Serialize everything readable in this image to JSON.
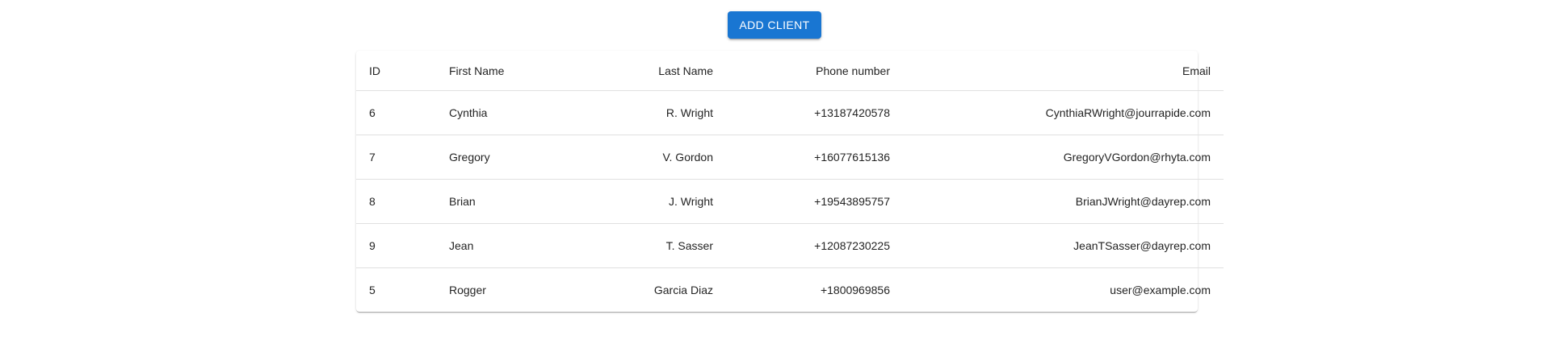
{
  "toolbar": {
    "add_label": "ADD CLIENT"
  },
  "table": {
    "headers": {
      "id": "ID",
      "first_name": "First Name",
      "last_name": "Last Name",
      "phone": "Phone number",
      "email": "Email"
    },
    "rows": [
      {
        "id": "6",
        "first_name": "Cynthia",
        "last_name": "R. Wright",
        "phone": "+13187420578",
        "email": "CynthiaRWright@jourrapide.com"
      },
      {
        "id": "7",
        "first_name": "Gregory",
        "last_name": "V. Gordon",
        "phone": "+16077615136",
        "email": "GregoryVGordon@rhyta.com"
      },
      {
        "id": "8",
        "first_name": "Brian",
        "last_name": "J. Wright",
        "phone": "+19543895757",
        "email": "BrianJWright@dayrep.com"
      },
      {
        "id": "9",
        "first_name": "Jean",
        "last_name": "T. Sasser",
        "phone": "+12087230225",
        "email": "JeanTSasser@dayrep.com"
      },
      {
        "id": "5",
        "first_name": "Rogger",
        "last_name": "Garcia Diaz",
        "phone": "+1800969856",
        "email": "user@example.com"
      }
    ],
    "row_actions": [
      "delete-icon",
      "edit-icon"
    ]
  },
  "colors": {
    "primary": "#1976d2",
    "icon": "#616161",
    "divider": "#e0e0e0"
  }
}
